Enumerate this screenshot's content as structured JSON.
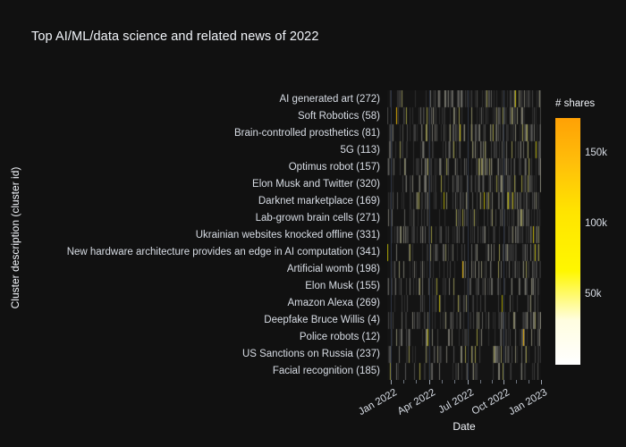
{
  "title": "Top AI/ML/data science and related news of 2022",
  "axes": {
    "y_title": "Cluster description (cluster id)",
    "x_title": "Date"
  },
  "colorbar": {
    "title": "# shares",
    "ticks": [
      {
        "label": "150k",
        "value": 150000
      },
      {
        "label": "100k",
        "value": 100000
      },
      {
        "label": "50k",
        "value": 50000
      }
    ],
    "colorscale": [
      {
        "stop": 0.0,
        "color": "#ffffff"
      },
      {
        "stop": 0.18,
        "color": "#fffde0"
      },
      {
        "stop": 0.38,
        "color": "#fff700"
      },
      {
        "stop": 0.62,
        "color": "#ffe400"
      },
      {
        "stop": 0.82,
        "color": "#ffbe0a"
      },
      {
        "stop": 1.0,
        "color": "#ffa105"
      }
    ],
    "min": 0,
    "max": 175000
  },
  "theme": {
    "background": "#111111",
    "plot_background": "#141414",
    "gridline": "#2b3240",
    "text": "#f2f5fa",
    "tick_text": "#d8dde5"
  },
  "chart_data": {
    "type": "heatmap",
    "title": "Top AI/ML/data science and related news of 2022",
    "xlabel": "Date",
    "ylabel": "Cluster description (cluster id)",
    "zlabel": "# shares",
    "grid": true,
    "legend_position": "right",
    "colorbar_title": "# shares",
    "zmin": 0,
    "zmax": 175000,
    "x_range": [
      "2021-12-20",
      "2023-01-20"
    ],
    "x_tick_labels": [
      "Jan 2022",
      "Apr 2022",
      "Jul 2022",
      "Oct 2022",
      "Jan 2023"
    ],
    "x_tick_positions": [
      437,
      480,
      523,
      563,
      605
    ],
    "y_categories": [
      "AI generated art (272)",
      "Soft Robotics (58)",
      "Brain-controlled prosthetics (81)",
      "5G (113)",
      "Optimus robot (157)",
      "Elon Musk and Twitter (320)",
      "Darknet marketplace (169)",
      "Lab-grown brain cells (271)",
      "Ukrainian websites knocked offline (331)",
      "New hardware architecture provides an edge in AI computation (341)",
      "Artificial womb (198)",
      "Elon Musk (155)",
      "Amazon Alexa (269)",
      "Deepfake Bruce Willis (4)",
      "Police robots (12)",
      "US Sanctions on Russia (237)",
      "Facial recognition (185)"
    ],
    "n_columns": 172,
    "note": "Sparse daily heatmap: most cells are empty (plot background); non-empty cells are small share counts rendered dark-olive, with a few brighter yellow/orange spikes."
  }
}
